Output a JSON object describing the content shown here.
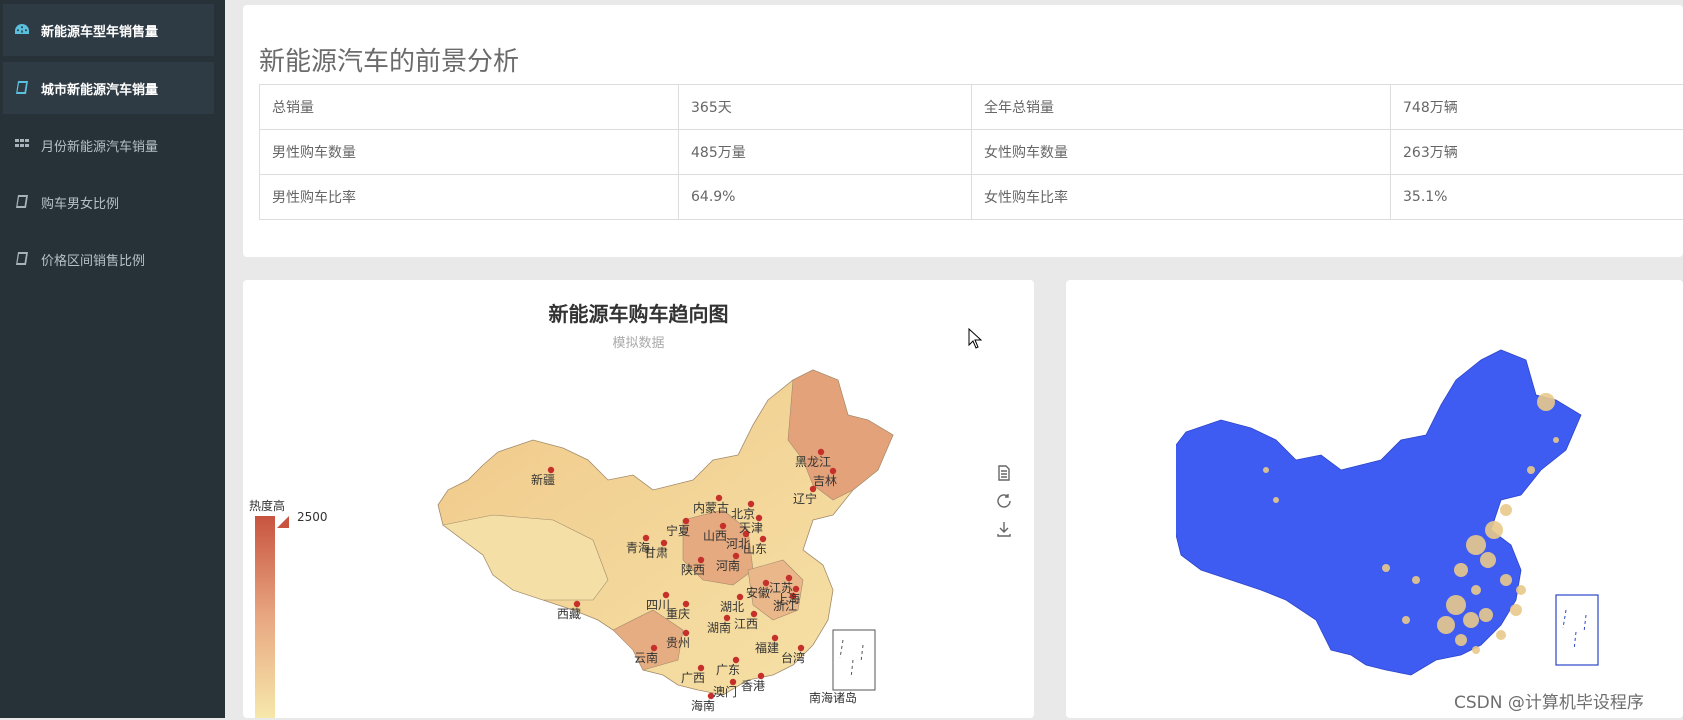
{
  "sidebar": {
    "items": [
      {
        "label": "新能源车型年销售量",
        "icon": "dashboard-icon",
        "active": true
      },
      {
        "label": "城市新能源汽车销量",
        "icon": "book-icon",
        "active": true
      },
      {
        "label": "月份新能源汽车销量",
        "icon": "grid-icon",
        "active": false
      },
      {
        "label": "购车男女比例",
        "icon": "book-icon",
        "active": false
      },
      {
        "label": "价格区间销售比例",
        "icon": "book-icon",
        "active": false
      }
    ]
  },
  "summary": {
    "title": "新能源汽车的前景分析",
    "rows": [
      [
        "总销量",
        "365天",
        "全年总销量",
        "748万辆"
      ],
      [
        "男性购车数量",
        "485万量",
        "女性购车数量",
        "263万辆"
      ],
      [
        "男性购车比率",
        "64.9%",
        "女性购车比率",
        "35.1%"
      ]
    ]
  },
  "map_chart": {
    "title": "新能源车购车趋向图",
    "subtitle": "模拟数据",
    "visual_map": {
      "high_label": "热度高",
      "max": "2500",
      "min": "0"
    },
    "provinces": [
      "黑龙江",
      "吉林",
      "辽宁",
      "新疆",
      "内蒙古",
      "北京",
      "天津",
      "宁夏",
      "山西",
      "河北",
      "青海",
      "甘肃",
      "山东",
      "陕西",
      "河南",
      "西藏",
      "四川",
      "安徽",
      "上海",
      "湖北",
      "江苏",
      "浙江",
      "重庆",
      "湖南",
      "江西",
      "贵州",
      "福建",
      "云南",
      "台湾",
      "广西",
      "广东",
      "香港",
      "澳门",
      "海南",
      "南海诸岛"
    ],
    "toolbox": [
      "data-view-icon",
      "restore-icon",
      "download-icon"
    ],
    "colors": {
      "low": "#f5e3a6",
      "high": "#c85440",
      "dot": "#c6302a"
    }
  },
  "scatter_map": {
    "colors": {
      "land": "#3f5cf2",
      "bubble": "#e8c98a"
    }
  },
  "watermark": "CSDN @计算机毕设程序"
}
